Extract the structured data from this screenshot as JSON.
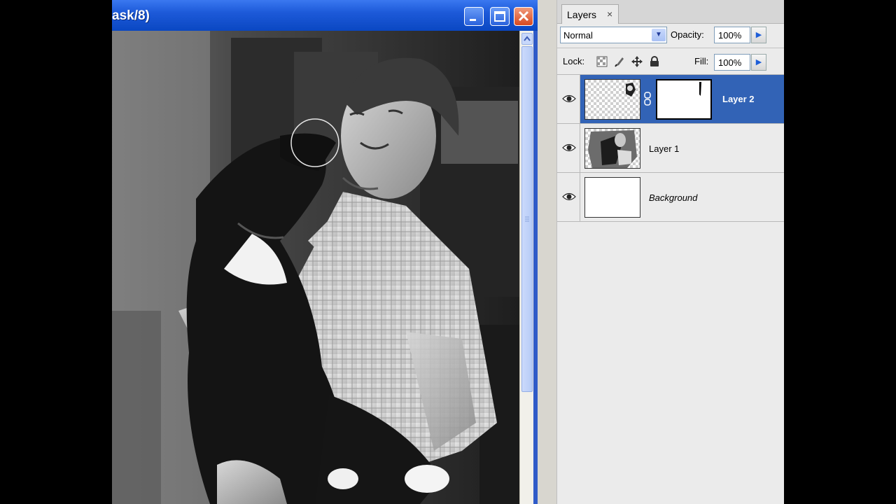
{
  "document_window": {
    "title": "ask/8)",
    "buttons": {
      "minimize": "_",
      "maximize": "☐",
      "close": "✕"
    }
  },
  "layers_panel": {
    "tab_label": "Layers",
    "tab_close": "×",
    "blend_mode": "Normal",
    "opacity_label": "Opacity:",
    "opacity_value": "100%",
    "lock_label": "Lock:",
    "lock_icons": [
      "lock-transparent-pixels-icon",
      "lock-image-pixels-icon",
      "lock-position-icon",
      "lock-all-icon"
    ],
    "fill_label": "Fill:",
    "fill_value": "100%",
    "layers": [
      {
        "name": "Layer 2",
        "selected": true,
        "visible": true,
        "has_mask": true
      },
      {
        "name": "Layer 1",
        "selected": false,
        "visible": true,
        "has_mask": false
      },
      {
        "name": "Background",
        "selected": false,
        "visible": true,
        "has_mask": false
      }
    ]
  },
  "colors": {
    "title_bar": "#1d5ad9",
    "selected_layer": "#3263b6",
    "panel_bg": "#ebebeb"
  }
}
